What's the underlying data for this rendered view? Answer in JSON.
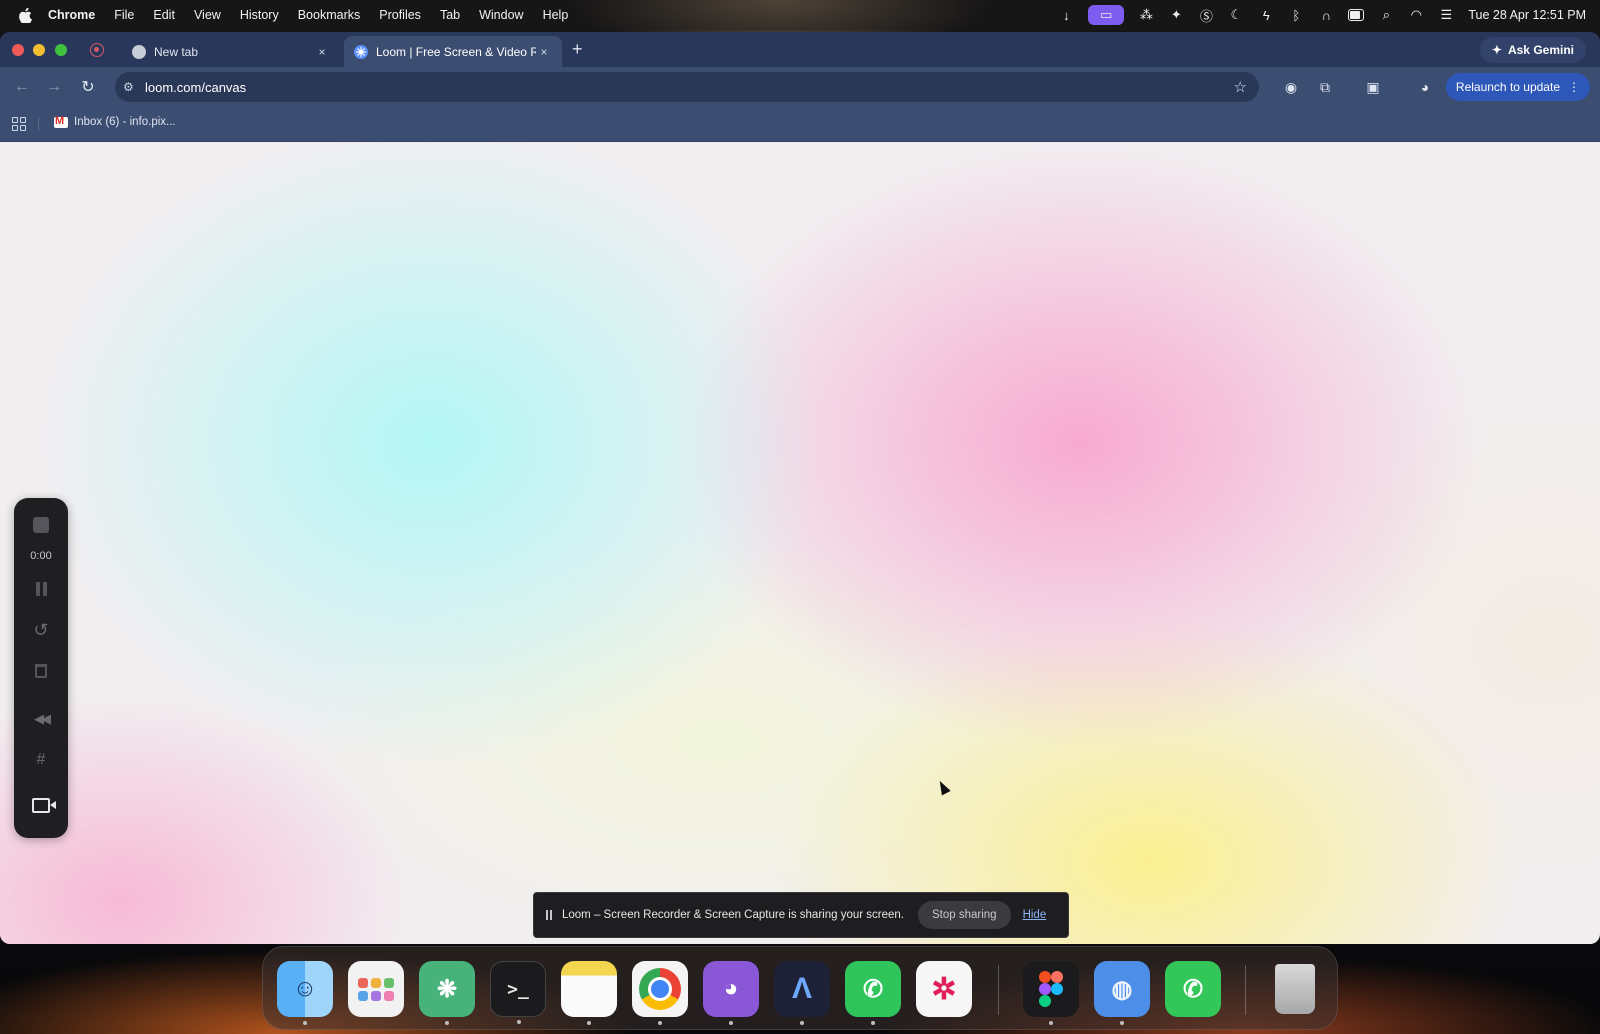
{
  "menubar": {
    "app_name": "Chrome",
    "items": [
      "File",
      "Edit",
      "View",
      "History",
      "Bookmarks",
      "Profiles",
      "Tab",
      "Window",
      "Help"
    ],
    "clock": "Tue 28 Apr  12:51 PM",
    "status_icons": [
      "arrow-down-icon",
      "screen-share-icon",
      "figma-icon",
      "sparkle-icon",
      "skype-icon",
      "moon-icon",
      "bolt-icon",
      "bluetooth-icon",
      "headphones-icon",
      "battery-icon",
      "search-icon",
      "wifi-icon",
      "control-center-icon"
    ]
  },
  "browser": {
    "tabs": [
      {
        "title": "New tab",
        "favicon": "chrome-icon",
        "active": false
      },
      {
        "title": "Loom | Free Screen & Video R",
        "favicon": "loom-icon",
        "active": true
      }
    ],
    "new_tab_symbol": "+",
    "close_symbol": "×",
    "ask_gemini_label": "Ask Gemini",
    "url": "loom.com/canvas",
    "relaunch_label": "Relaunch to update",
    "bookmarks": [
      {
        "label": "Inbox (6) - info.pix...",
        "icon": "gmail-icon"
      }
    ]
  },
  "loom_controls": {
    "timer": "0:00",
    "buttons": [
      "stop-icon",
      "pause-icon",
      "restart-icon",
      "trash-icon",
      "rewind-icon",
      "grid-icon",
      "camera-icon"
    ]
  },
  "share_bar": {
    "message": "Loom – Screen Recorder & Screen Capture is sharing your screen.",
    "stop_label": "Stop sharing",
    "hide_label": "Hide"
  },
  "dock": {
    "apps": [
      "Finder",
      "Launchpad",
      "ChatGPT",
      "Terminal",
      "Notes",
      "Google Chrome",
      "GitHub Desktop",
      "Arc",
      "WhatsApp",
      "Slack",
      "Figma",
      "Finder Helper",
      "Phone",
      "Trash"
    ]
  },
  "colors": {
    "tabstrip": "#29375a",
    "toolbar": "#3c4d72",
    "accent_blue": "#2d57b8",
    "loom_controls_bg": "#1f1f22"
  }
}
